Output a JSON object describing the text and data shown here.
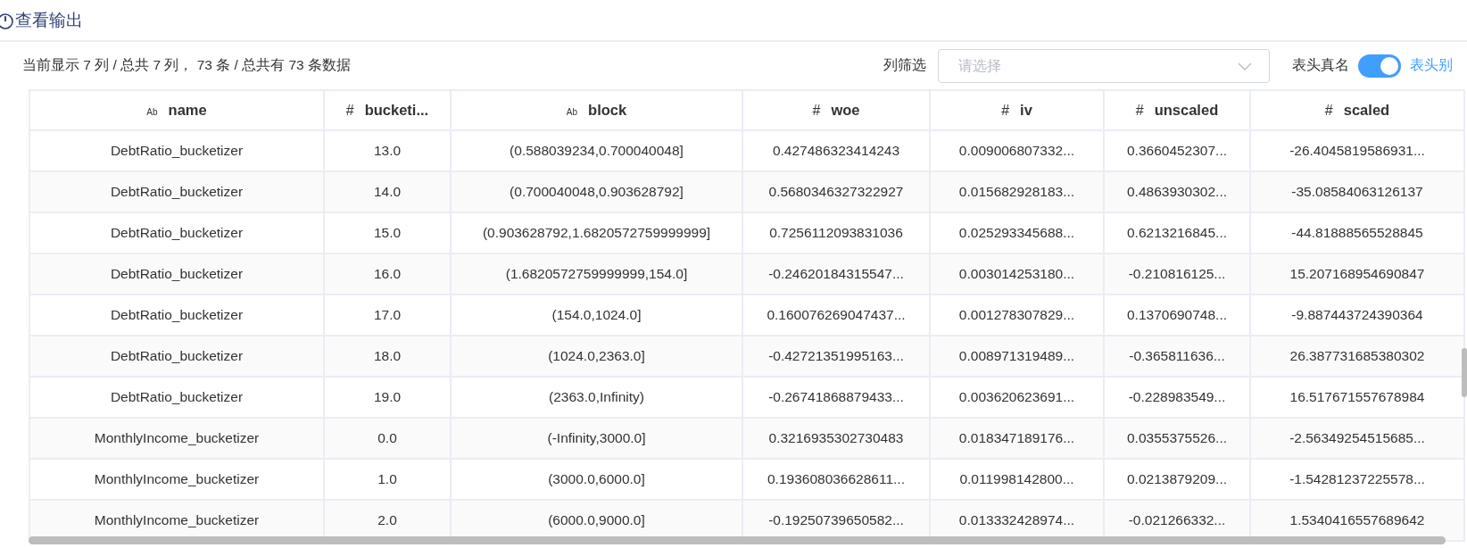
{
  "header": {
    "title": "查看输出"
  },
  "toolbar": {
    "summary": "当前显示 7 列 / 总共 7 列， 73 条 / 总共有 73 条数据",
    "filter_label": "列筛选",
    "filter": {
      "placeholder": "请选择"
    },
    "toggle_label_left": "表头真名",
    "toggle": {
      "on": true
    },
    "toggle_label_right": "表头别"
  },
  "table": {
    "columns": [
      {
        "type_icon": "Ab",
        "label": "name"
      },
      {
        "type_icon": "#",
        "label": "bucketi..."
      },
      {
        "type_icon": "Ab",
        "label": "block"
      },
      {
        "type_icon": "#",
        "label": "woe"
      },
      {
        "type_icon": "#",
        "label": "iv"
      },
      {
        "type_icon": "#",
        "label": "unscaled"
      },
      {
        "type_icon": "#",
        "label": "scaled"
      }
    ],
    "rows": [
      [
        "DebtRatio_bucketizer",
        "13.0",
        "(0.588039234,0.700040048]",
        "0.427486323414243",
        "0.009006807332...",
        "0.3660452307...",
        "-26.4045819586931..."
      ],
      [
        "DebtRatio_bucketizer",
        "14.0",
        "(0.700040048,0.903628792]",
        "0.5680346327322927",
        "0.015682928183...",
        "0.4863930302...",
        "-35.08584063126137"
      ],
      [
        "DebtRatio_bucketizer",
        "15.0",
        "(0.903628792,1.6820572759999999]",
        "0.7256112093831036",
        "0.025293345688...",
        "0.6213216845...",
        "-44.81888565528845"
      ],
      [
        "DebtRatio_bucketizer",
        "16.0",
        "(1.6820572759999999,154.0]",
        "-0.24620184315547...",
        "0.003014253180...",
        "-0.210816125...",
        "15.207168954690847"
      ],
      [
        "DebtRatio_bucketizer",
        "17.0",
        "(154.0,1024.0]",
        "0.160076269047437...",
        "0.001278307829...",
        "0.1370690748...",
        "-9.887443724390364"
      ],
      [
        "DebtRatio_bucketizer",
        "18.0",
        "(1024.0,2363.0]",
        "-0.42721351995163...",
        "0.008971319489...",
        "-0.365811636...",
        "26.387731685380302"
      ],
      [
        "DebtRatio_bucketizer",
        "19.0",
        "(2363.0,Infinity)",
        "-0.26741868879433...",
        "0.003620623691...",
        "-0.228983549...",
        "16.517671557678984"
      ],
      [
        "MonthlyIncome_bucketizer",
        "0.0",
        "(-Infinity,3000.0]",
        "0.3216935302730483",
        "0.018347189176...",
        "0.0355375526...",
        "-2.56349254515685..."
      ],
      [
        "MonthlyIncome_bucketizer",
        "1.0",
        "(3000.0,6000.0]",
        "0.193608036628611...",
        "0.011998142800...",
        "0.0213879209...",
        "-1.54281237225578..."
      ],
      [
        "MonthlyIncome_bucketizer",
        "2.0",
        "(6000.0,9000.0]",
        "-0.19250739650582...",
        "0.013332428974...",
        "-0.021266332...",
        "1.5340416557689642"
      ]
    ]
  }
}
